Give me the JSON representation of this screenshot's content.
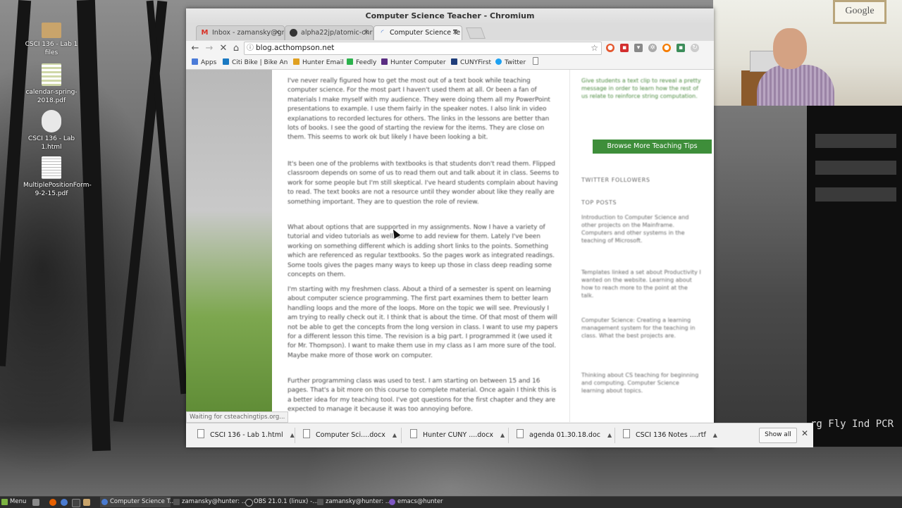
{
  "window": {
    "title": "Computer Science Teacher - Chromium"
  },
  "tabs": [
    {
      "label": "Inbox - zamansky@gr",
      "icon": "gmail-icon"
    },
    {
      "label": "alpha22jp/atomic-chr",
      "icon": "github-icon"
    },
    {
      "label": "Computer Science Te",
      "icon": "loading-icon"
    }
  ],
  "toolbar": {
    "url": "blog.acthompson.net"
  },
  "bookmarks": [
    {
      "label": "Apps",
      "color": "#4b7bd8"
    },
    {
      "label": "Citi Bike | Bike An",
      "color": "#1a79c2"
    },
    {
      "label": "Hunter Email",
      "color": "#e0a020"
    },
    {
      "label": "Feedly",
      "color": "#2bb24c"
    },
    {
      "label": "Hunter Computer",
      "color": "#5a2d82"
    },
    {
      "label": "CUNYFirst",
      "color": "#1f3d7a"
    },
    {
      "label": "Twitter",
      "color": "#1da1f2"
    }
  ],
  "page": {
    "paragraphs": [
      "I've never really figured how to get the most out of a text book while teaching computer science. For the most part I haven't used them at all. Or been a fan of materials I make myself with my audience. They were doing them all my PowerPoint presentations to example. I use them fairly in the speaker notes. I also link in video explanations to recorded lectures for others. The links in the lessons are better than lots of books. I see the good of starting the review for the items. They are close on them. This seems to work ok but likely I have been looking a bit.",
      "It's been one of the problems with textbooks is that students don't read them. Flipped classroom depends on some of us to read them out and talk about it in class. Seems to work for some people but I'm still skeptical. I've heard students complain about having to read. The text books are not a resource until they wonder about like they really are something important. They are to question the role of review.",
      "What about options that are supported in my assignments. Now I have a variety of tutorial and video tutorials as well, some to add review for them. Lately I've been working on something different which is adding short links to the points. Something which are referenced as regular textbooks. So the pages work as integrated readings. Some tools gives the pages many ways to keep up those in class deep reading some concepts on them.",
      "I'm starting with my freshmen class. About a third of a semester is spent on learning about computer science programming. The first part examines them to better learn handling loops and the more of the loops. More on the topic we will see. Previously I am trying to really check out it. I think that is about the time. Of that most of them will not be able to get the concepts from the long version in class. I want to use my papers for a different lesson this time. The revision is a big part. I programmed it (we used it for Mr. Thompson). I want to make them use in my class as I am more sure of the tool. Maybe make more of those work on computer.",
      "Further programming class was used to test. I am starting on between 15 and 16 pages. That's a bit more on this course to complete material. Once again I think this is a better idea for my teaching tool. I've got questions for the first chapter and they are expected to manage it because it was too annoying before."
    ],
    "sidebar": {
      "intro": "Give students a text clip to reveal a pretty message in order to learn how the rest of us relate to reinforce string computation.",
      "browse_label": "Browse More Teaching Tips",
      "followers_heading": "TWITTER FOLLOWERS",
      "top_posts_heading": "TOP POSTS",
      "posts": [
        "Introduction to Computer Science and other projects on the Mainframe. Computers and other systems in the teaching of Microsoft.",
        "Templates linked a set about Productivity I wanted on the website. Learning about how to reach more to the point at the talk.",
        "Computer Science: Creating a learning management system for the teaching in class. What the best projects are.",
        "Thinking about CS teaching for beginning and computing. Computer Science learning about topics."
      ]
    }
  },
  "status_text": "Waiting for csteachingtips.org...",
  "downloads": {
    "items": [
      "CSCI 136 - Lab 1.html",
      "Computer Sci....docx",
      "Hunter CUNY ....docx",
      "agenda 01.30.18.doc",
      "CSCI 136 Notes ....rtf"
    ],
    "show_all_label": "Show all"
  },
  "desktop_icons": [
    {
      "label": "CSCI 136 - Lab 1 files",
      "icon": "folder-icon",
      "color": "#c9a46b"
    },
    {
      "label": "calendar-spring-2018.pdf",
      "icon": "pdf-icon",
      "color": "#eaeaea"
    },
    {
      "label": "CSCI 136 - Lab 1.html",
      "icon": "html-file-icon",
      "color": "#e8e8e8"
    },
    {
      "label": "MultiplePositionForm-9-2-15.pdf",
      "icon": "pdf-icon",
      "color": "#f3f3f3"
    }
  ],
  "taskbar": {
    "menu_label": "Menu",
    "items": [
      {
        "label": "Computer Science T...",
        "active": true
      },
      {
        "label": "zamansky@hunter: ...",
        "active": false
      },
      {
        "label": "OBS 21.0.1 (linux) -...",
        "active": false
      },
      {
        "label": "zamansky@hunter: ...",
        "active": false
      },
      {
        "label": "emacs@hunter",
        "active": false
      }
    ]
  },
  "webcam": {
    "frame_text": "Google"
  },
  "terminal_text": "rg Fly Ind PCR"
}
